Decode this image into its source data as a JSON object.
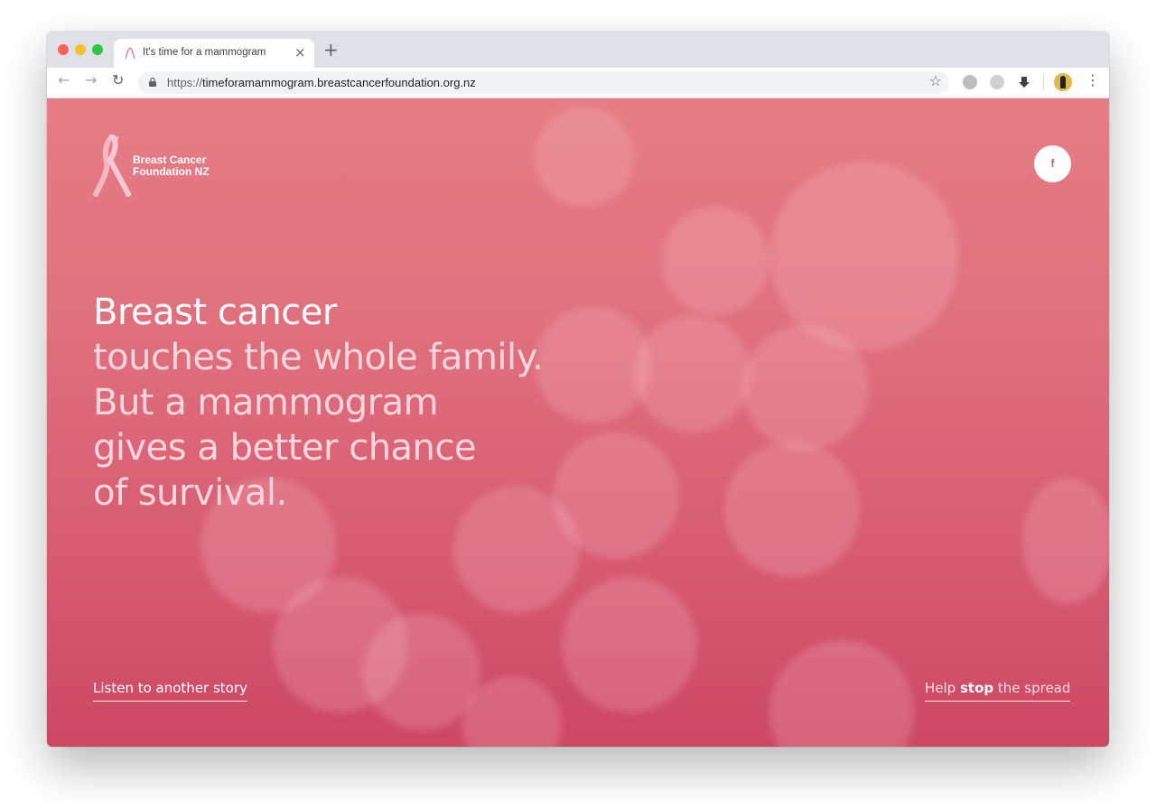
{
  "browser": {
    "tab_title": "It's time for a mammogram",
    "tab_close": "×",
    "new_tab": "+",
    "url_scheme": "https://",
    "url_host": "timeforamammogram.breastcancerfoundation.org.nz",
    "nav_back": "←",
    "nav_forward": "→",
    "nav_reload": "↻",
    "star": "☆",
    "menu": "⋮"
  },
  "site": {
    "logo_line1": "Breast Cancer",
    "logo_line2": "Foundation NZ",
    "facebook": "f",
    "headline": {
      "line1": "Breast cancer",
      "line2": "touches the whole family.",
      "line3": "But a mammogram",
      "line4": "gives a better chance",
      "line5": "of survival."
    },
    "listen_link": "Listen to another story",
    "help_link": {
      "prefix": "Help ",
      "emphasis": "stop",
      "suffix": " the spread"
    }
  },
  "colors": {
    "background_top": "#e67d85",
    "background_bottom": "#cc4763",
    "headline_primary": "#ffffff",
    "headline_secondary": "#fbd6dc",
    "ribbon": "#f6b7c4"
  }
}
